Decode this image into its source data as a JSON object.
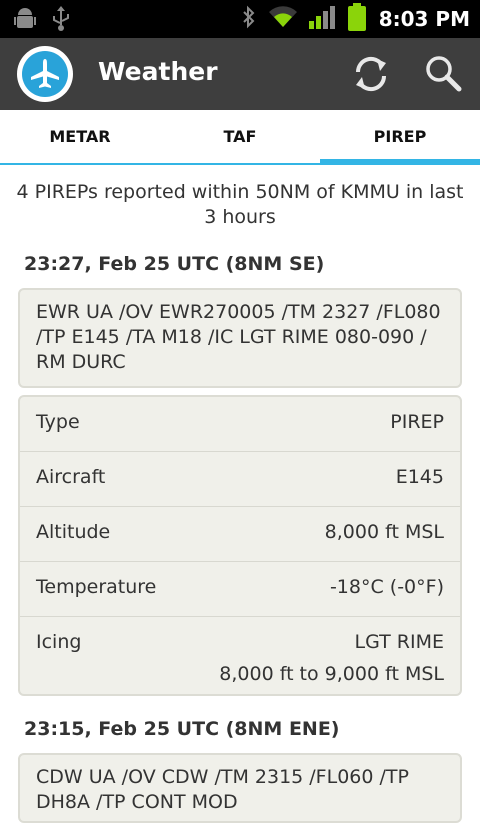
{
  "status_bar": {
    "time": "8:03 PM",
    "left_icons": [
      "android-debug-icon",
      "usb-icon"
    ],
    "right_icons": [
      "bluetooth-icon",
      "wifi-icon",
      "signal-icon",
      "battery-icon"
    ]
  },
  "action_bar": {
    "title": "Weather",
    "actions": [
      "refresh-icon",
      "search-icon"
    ]
  },
  "tabs": [
    {
      "label": "METAR",
      "active": false
    },
    {
      "label": "TAF",
      "active": false
    },
    {
      "label": "PIREP",
      "active": true
    }
  ],
  "summary": "4 PIREPs reported within 50NM of KMMU in last 3 hours",
  "reports": [
    {
      "header": "23:27, Feb 25 UTC (8NM SE)",
      "raw": "EWR UA /OV EWR270005 /TM 2327 /FL080 /TP E145 /TA M18 /IC LGT RIME 080-090 / RM DURC",
      "details": [
        {
          "label": "Type",
          "value": "PIREP"
        },
        {
          "label": "Aircraft",
          "value": "E145"
        },
        {
          "label": "Altitude",
          "value": "8,000 ft MSL"
        },
        {
          "label": "Temperature",
          "value": "-18°C (-0°F)"
        },
        {
          "label": "Icing",
          "value": "LGT RIME",
          "value2": "8,000 ft to 9,000 ft MSL"
        }
      ]
    },
    {
      "header": "23:15, Feb 25 UTC (8NM ENE)",
      "raw": "CDW UA /OV CDW /TM 2315 /FL060 /TP DH8A /TP CONT MOD"
    }
  ],
  "colors": {
    "status_bar": "#000000",
    "action_bar": "#3e3e3e",
    "accent": "#33b5e5",
    "logo_blue": "#29a3d9",
    "card_bg": "#f0f0ea",
    "battery": "#8bd40a"
  }
}
